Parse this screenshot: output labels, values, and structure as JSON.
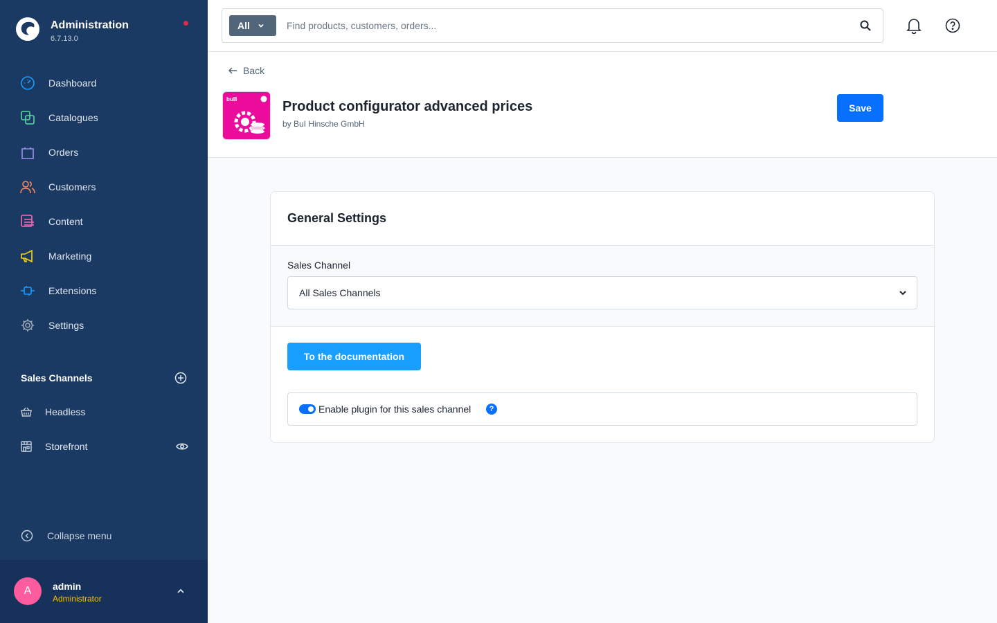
{
  "brand": {
    "title": "Administration",
    "version": "6.7.13.0",
    "notification_color": "#de294c"
  },
  "nav": [
    {
      "label": "Dashboard",
      "icon": "dashboard-icon",
      "color": "#189eff"
    },
    {
      "label": "Catalogues",
      "icon": "catalogues-icon",
      "color": "#57d9a3"
    },
    {
      "label": "Orders",
      "icon": "orders-icon",
      "color": "#a092f0"
    },
    {
      "label": "Customers",
      "icon": "customers-icon",
      "color": "#f88962"
    },
    {
      "label": "Content",
      "icon": "content-icon",
      "color": "#ff68b4"
    },
    {
      "label": "Marketing",
      "icon": "marketing-icon",
      "color": "#ffd700"
    },
    {
      "label": "Extensions",
      "icon": "extensions-icon",
      "color": "#189eff"
    },
    {
      "label": "Settings",
      "icon": "settings-icon",
      "color": "#9aa8b5"
    }
  ],
  "sales_channels": {
    "title": "Sales Channels",
    "items": [
      {
        "label": "Headless",
        "icon": "basket-icon"
      },
      {
        "label": "Storefront",
        "icon": "storefront-icon"
      }
    ]
  },
  "collapse_label": "Collapse menu",
  "user": {
    "initial": "A",
    "name": "admin",
    "role": "Administrator"
  },
  "search": {
    "type_label": "All",
    "placeholder": "Find products, customers, orders..."
  },
  "page": {
    "back_label": "Back",
    "title": "Product configurator advanced prices",
    "author": "by BuI Hinsche GmbH",
    "save_label": "Save",
    "icon_text": "buB"
  },
  "card": {
    "title": "General Settings",
    "field_label": "Sales Channel",
    "select_value": "All Sales Channels",
    "doc_button": "To the documentation",
    "toggle_label": "Enable plugin for this sales channel",
    "toggle_on": true,
    "help_glyph": "?"
  },
  "colors": {
    "sidebar": "#1b3a63",
    "primary": "#0870ff",
    "doc_button": "#189eff",
    "plugin_icon": "#ec0c9c",
    "avatar": "#ff5b9f",
    "role": "#ffc200"
  }
}
